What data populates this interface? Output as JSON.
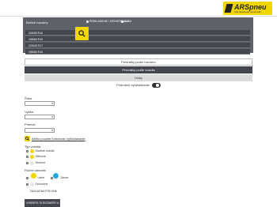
{
  "header": {
    "logo_text": "ARSpneu",
    "logo_subtitle": "Váš dodavatel pneumatik"
  },
  "search_panel": {
    "title": "Beživé rozmery",
    "radio_options": [
      "PRIHLASENIE / REGISTRACIA",
      "AUTA"
    ],
    "rows": [
      "205/55 R16",
      "195/65 R15",
      "225/45 R17",
      "185/65 R15"
    ]
  },
  "bars": {
    "by_size": "Prevrátky podle rozmeru",
    "by_vehicle": "Prevrátky podle vozidla",
    "tips": "Disky",
    "advanced_label": "Podrobné vyhledávanie"
  },
  "form": {
    "width_label": "Šírka",
    "profile_label": "Výška",
    "diameter_label": "Priemer",
    "advanced_link": "Alebo použite funkčnosť vyhľadávanie",
    "vehicle_type_label": "Typ vozidla",
    "vehicle_types": [
      "Osobné vozidlo",
      "Offroove",
      "Terénne"
    ],
    "season_label": "Ročné obdobie",
    "seasons": [
      "Letne",
      "Zimne",
      "Celoročné"
    ],
    "reset_label": "ZAKLADNA POLOHA",
    "submit_label": "VYBERTE Si ROZMERY A"
  },
  "colors": {
    "accent": "#f2d600",
    "panel": "#5e6168",
    "dark_bar": "#43464c"
  }
}
